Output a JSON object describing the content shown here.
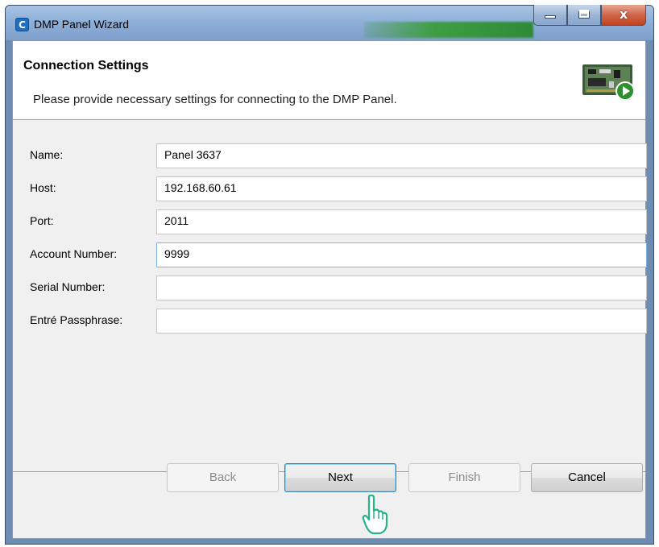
{
  "window": {
    "title": "DMP Panel Wizard",
    "app_icon_glyph": "C",
    "controls": {
      "minimize_icon": "minimize-icon",
      "maximize_icon": "maximize-icon",
      "close_glyph": "x"
    }
  },
  "header": {
    "title": "Connection Settings",
    "description": "Please provide necessary settings for connecting to the DMP Panel.",
    "image": "circuit-board-with-play-arrow"
  },
  "form": {
    "fields": [
      {
        "label": "Name:",
        "value": "Panel 3637"
      },
      {
        "label": "Host:",
        "value": "192.168.60.61"
      },
      {
        "label": "Port:",
        "value": "2011"
      },
      {
        "label": "Account Number:",
        "value": "9999",
        "focused": true
      },
      {
        "label": "Serial Number:",
        "value": ""
      },
      {
        "label": "Entré Passphrase:",
        "value": ""
      }
    ]
  },
  "buttons": {
    "back": {
      "label": "Back",
      "enabled": false
    },
    "next": {
      "label": "Next",
      "enabled": true,
      "default": true
    },
    "finish": {
      "label": "Finish",
      "enabled": false
    },
    "cancel": {
      "label": "Cancel",
      "enabled": true
    }
  },
  "colors": {
    "accent_focus": "#7eb4ea",
    "cursor": "#27b38a",
    "close_button": "#c4421f"
  }
}
